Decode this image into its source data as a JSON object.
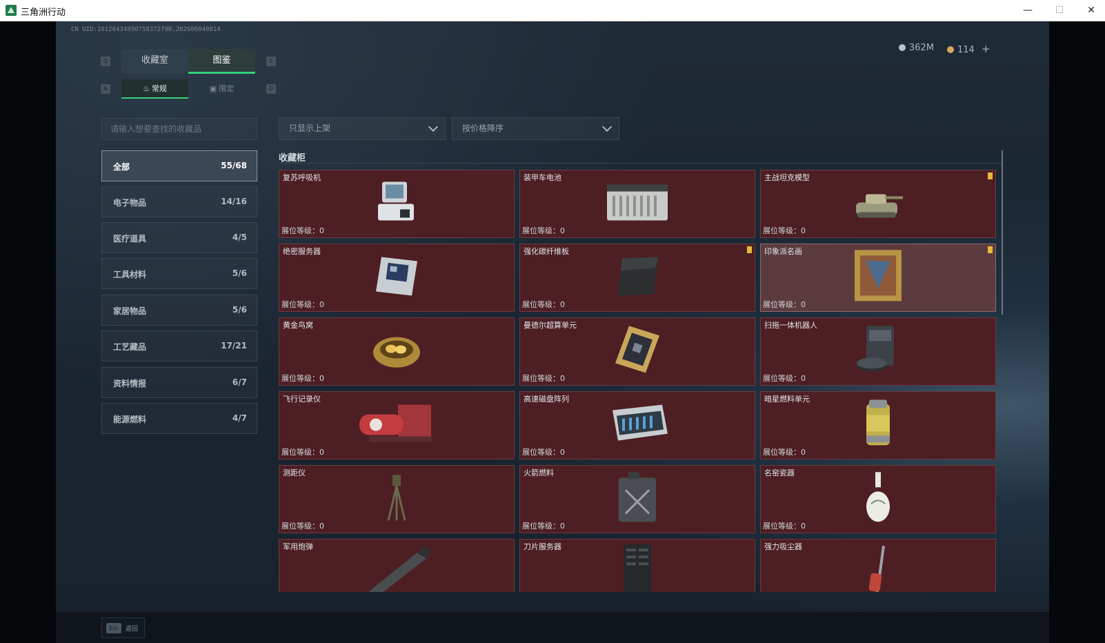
{
  "window": {
    "title": "三角洲行动",
    "minimize": "—",
    "maximize": "☐",
    "close": "✕"
  },
  "header": {
    "uid": "CN UID:1612643409075837279B,202606040814",
    "currency": [
      {
        "icon": "silver-coin-icon",
        "value": "362M",
        "color": "#b9c2ca"
      },
      {
        "icon": "gold-coin-icon",
        "value": "114",
        "color": "#d8a85a"
      }
    ],
    "add_label": "+"
  },
  "tabs": [
    {
      "label": "收藏室",
      "active": false
    },
    {
      "label": "图鉴",
      "active": true
    }
  ],
  "tab_keys": {
    "left": "Q",
    "right": "E"
  },
  "subtabs": [
    {
      "label": "常规",
      "active": true
    },
    {
      "label": "限定",
      "active": false
    }
  ],
  "subtab_keys": {
    "left": "A",
    "right": "D"
  },
  "search": {
    "placeholder": "请输入想要查找的收藏品"
  },
  "filters": {
    "listing": "只显示上架",
    "sort": "按价格降序"
  },
  "categories": [
    {
      "label": "全部",
      "count": "55/68"
    },
    {
      "label": "电子物品",
      "count": "14/16"
    },
    {
      "label": "医疗道具",
      "count": "4/5"
    },
    {
      "label": "工具材料",
      "count": "5/6"
    },
    {
      "label": "家居物品",
      "count": "5/6"
    },
    {
      "label": "工艺藏品",
      "count": "17/21"
    },
    {
      "label": "资料情报",
      "count": "6/7"
    },
    {
      "label": "能源燃料",
      "count": "4/7"
    }
  ],
  "section_title": "收藏柜",
  "level_label": "展位等级：0",
  "items": [
    {
      "name": "复苏呼吸机",
      "icon": "ventilator-icon",
      "badge": false
    },
    {
      "name": "装甲车电池",
      "icon": "battery-icon",
      "badge": false
    },
    {
      "name": "主战坦克模型",
      "icon": "tank-model-icon",
      "badge": true
    },
    {
      "name": "绝密服务器",
      "icon": "server-board-icon",
      "badge": false
    },
    {
      "name": "强化碳纤维板",
      "icon": "carbon-plate-icon",
      "badge": true
    },
    {
      "name": "印象派名画",
      "icon": "painting-icon",
      "badge": true
    },
    {
      "name": "黄金鸟窝",
      "icon": "golden-nest-icon",
      "badge": false
    },
    {
      "name": "曼德尔超算单元",
      "icon": "compute-unit-icon",
      "badge": false
    },
    {
      "name": "扫拖一体机器人",
      "icon": "robot-vacuum-icon",
      "badge": false
    },
    {
      "name": "飞行记录仪",
      "icon": "flight-recorder-icon",
      "badge": false
    },
    {
      "name": "高速磁盘阵列",
      "icon": "disk-array-icon",
      "badge": false
    },
    {
      "name": "暗星燃料单元",
      "icon": "fuel-cell-icon",
      "badge": false
    },
    {
      "name": "测距仪",
      "icon": "rangefinder-icon",
      "badge": false
    },
    {
      "name": "火箭燃料",
      "icon": "rocket-fuel-icon",
      "badge": false
    },
    {
      "name": "名窑瓷器",
      "icon": "porcelain-vase-icon",
      "badge": false
    },
    {
      "name": "军用炮弹",
      "icon": "artillery-shell-icon",
      "badge": false
    },
    {
      "name": "刀片服务器",
      "icon": "blade-server-icon",
      "badge": false
    },
    {
      "name": "强力吸尘器",
      "icon": "vacuum-cleaner-icon",
      "badge": false
    }
  ],
  "footer": {
    "esc_key": "Esc",
    "back_label": "返回"
  }
}
